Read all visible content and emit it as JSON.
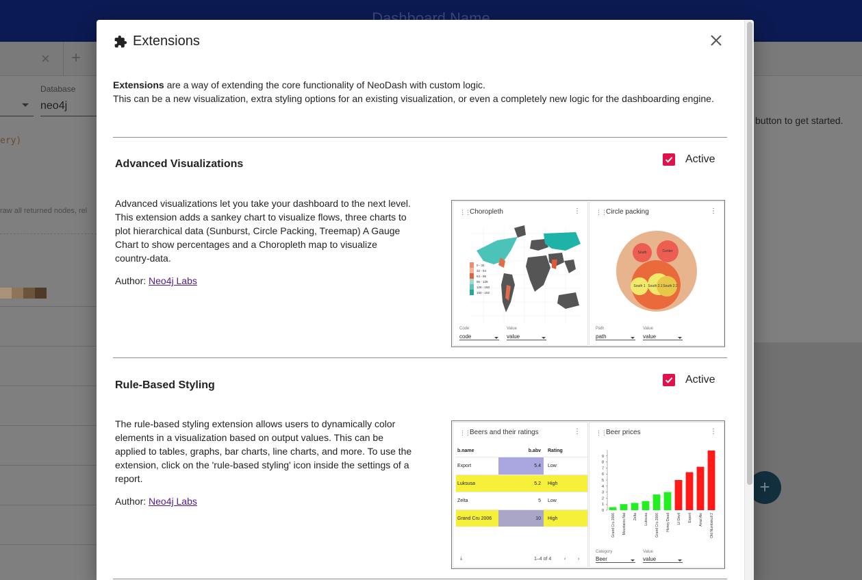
{
  "background": {
    "dashboard_title": "Dashboard Name",
    "database_label": "Database",
    "database_value": "neo4j",
    "code_fragment": "ery)",
    "hint_fragment": "raw all returned nodes, rel",
    "right_hint": "button to get started.",
    "swatch_colors": [
      "#a89279",
      "#8e7559",
      "#6c543b",
      "#4d3a28"
    ]
  },
  "modal": {
    "title": "Extensions",
    "header_icon": "puzzle-icon",
    "close_icon": "close-icon",
    "intro_bold": "Extensions",
    "intro_rest": " are a way of extending the core functionality of NeoDash with custom logic.",
    "intro_line2": "This can be a new visualization, extra styling options for an existing visualization, or even a completely new logic for the dashboarding engine."
  },
  "extensions": [
    {
      "name": "Advanced Visualizations",
      "active_label": "Active",
      "active": true,
      "description": "Advanced visualizations let you take your dashboard to the next level. This extension adds a sankey chart to visualize flows, three charts to plot hierarchical data (Sunburst, Circle Packing, Treemap) A Gauge Chart to show percentages and a Choropleth map to visualize country-data.",
      "author_label": "Author: ",
      "author_link": "Neo4j Labs",
      "preview": {
        "left_title": "Choropleth",
        "right_title": "Circle packing",
        "left_fields": [
          {
            "label": "Code",
            "value": "code"
          },
          {
            "label": "Value",
            "value": "value"
          }
        ],
        "right_fields": [
          {
            "label": "Path",
            "value": "path"
          },
          {
            "label": "Value",
            "value": "value"
          }
        ],
        "legend": [
          "0 - 32",
          "32 - 64",
          "64 - 96",
          "96 - 128",
          "128 - 160",
          "160 - 192"
        ],
        "bubble_labels": [
          "South",
          "Center",
          "South 1",
          "South 2.1",
          "South 2.2"
        ]
      }
    },
    {
      "name": "Rule-Based Styling",
      "active_label": "Active",
      "active": true,
      "description": "The rule-based styling extension allows users to dynamically color elements in a visualization based on output values. This can be applied to tables, graphs, bar charts, line charts, and more. To use the extension, click on the 'rule-based styling' icon inside the settings of a report.",
      "author_label": "Author: ",
      "author_link": "Neo4j Labs",
      "preview": {
        "left_title": "Beers and their ratings",
        "right_title": "Beer prices",
        "table_headers": [
          "b.name",
          "b.abv",
          "Rating"
        ],
        "table_rows": [
          {
            "name": "Export",
            "abv": "5.4",
            "rating": "Low",
            "row_color": "",
            "abv_color": "#a9a6e0"
          },
          {
            "name": "Luksusa",
            "abv": "5.2",
            "rating": "High",
            "row_color": "#f6f03a",
            "abv_color": "#f6f03a"
          },
          {
            "name": "Zelta",
            "abv": "5",
            "rating": "Low",
            "row_color": "",
            "abv_color": ""
          },
          {
            "name": "Grand Cru 2006",
            "abv": "10",
            "rating": "High",
            "row_color": "#f6f03a",
            "abv_color": "#a9a6c8"
          }
        ],
        "pagination": "1–4 of 4",
        "right_fields": [
          {
            "label": "Category",
            "value": "Beer"
          },
          {
            "label": "Value",
            "value": "value"
          }
        ]
      }
    }
  ],
  "chart_data": {
    "type": "bar",
    "title": "Beer prices",
    "categories": [
      "Grand Cru 2006",
      "Mountains Nat",
      "Zelta",
      "Luksusa",
      "Grand Cru 2006",
      "Honey Dead",
      "Lil Devil",
      "Export",
      "Amol Ale",
      "Old Numbskull 2"
    ],
    "values": [
      0.5,
      1,
      1.2,
      1.5,
      2.6,
      3,
      5,
      6.3,
      7.2,
      9.9
    ],
    "colors": [
      "#22ee22",
      "#22ee22",
      "#22ee22",
      "#22ee22",
      "#22ee22",
      "#22ee22",
      "#ff1a1a",
      "#ff1a1a",
      "#ff1a1a",
      "#ff1a1a"
    ],
    "yticks": [
      "0",
      "1",
      "2",
      "3",
      "4",
      "5",
      "6",
      "7",
      "8",
      "9"
    ],
    "ylim": [
      0,
      10
    ]
  }
}
